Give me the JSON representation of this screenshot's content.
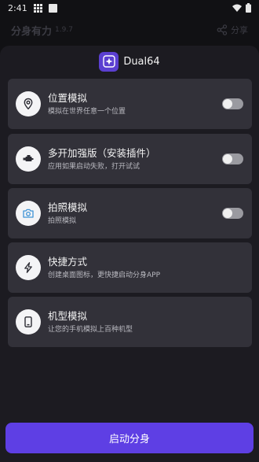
{
  "status_bar": {
    "time": "2:41"
  },
  "background": {
    "title": "分身有力",
    "version": "1.9.7",
    "share_label": "分享"
  },
  "sheet": {
    "app_name": "Dual64",
    "options": [
      {
        "title": "位置模拟",
        "subtitle": "模拟在世界任意一个位置",
        "icon": "location-pin-icon",
        "toggle": false
      },
      {
        "title": "多开加强版（安装插件）",
        "subtitle": "应用如果启动失败，打开试试",
        "icon": "engine-icon",
        "toggle": false
      },
      {
        "title": "拍照模拟",
        "subtitle": "拍照模拟",
        "icon": "camera-icon",
        "toggle": false
      },
      {
        "title": "快捷方式",
        "subtitle": "创建桌面图标，更快捷启动分身APP",
        "icon": "lightning-icon"
      },
      {
        "title": "机型模拟",
        "subtitle": "让您的手机模拟上百种机型",
        "icon": "phone-icon"
      }
    ]
  },
  "actions": {
    "start_label": "启动分身"
  },
  "colors": {
    "accent": "#5e3fe4",
    "card": "#323139",
    "sheet": "#1c1b21"
  }
}
